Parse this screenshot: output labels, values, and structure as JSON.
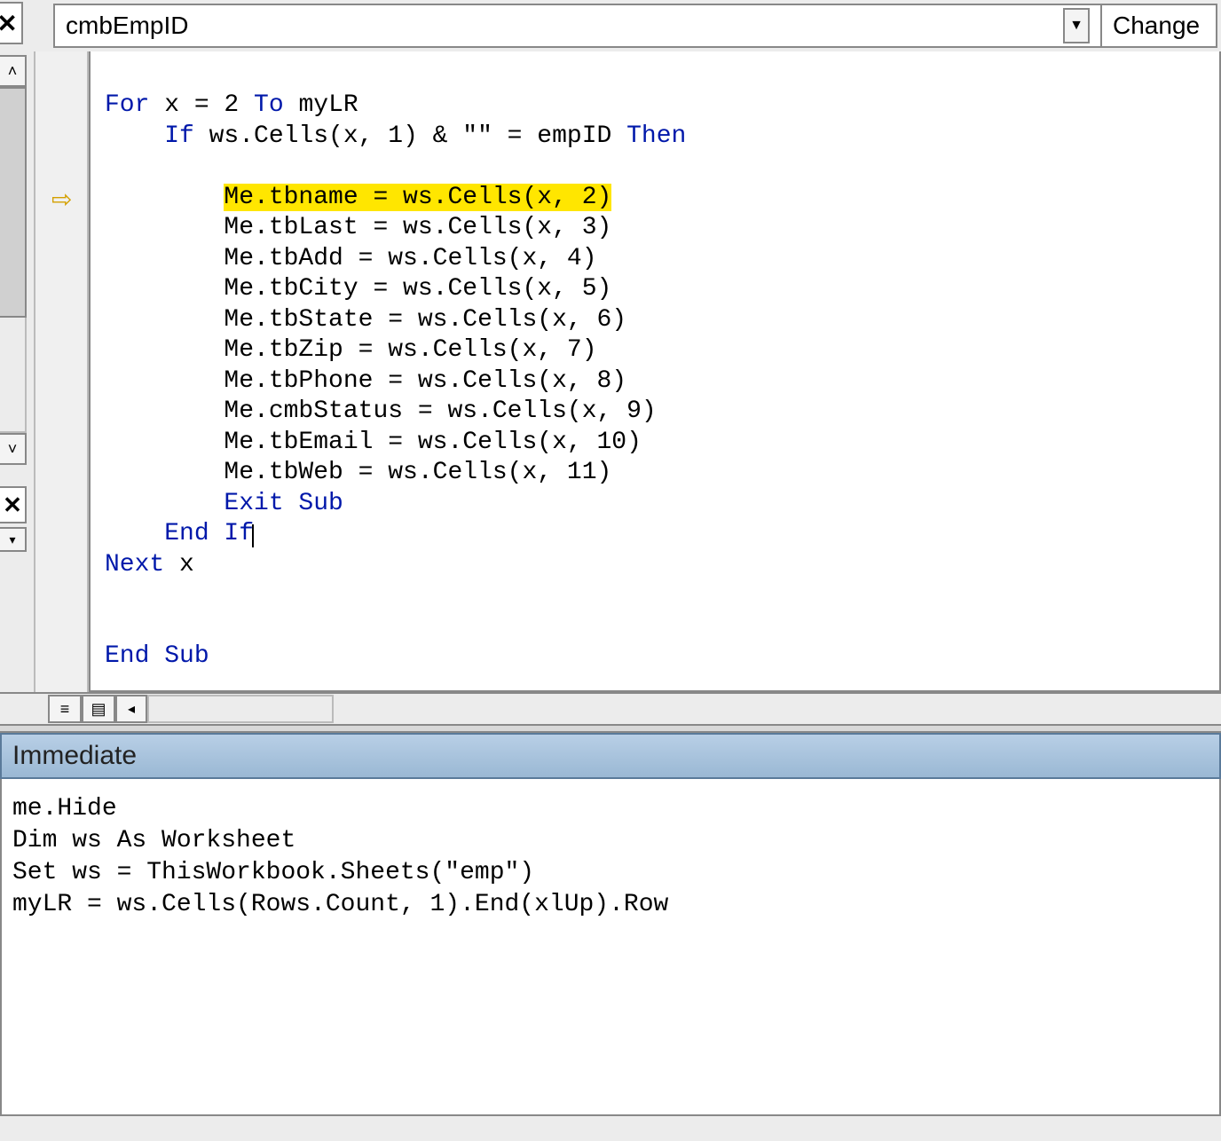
{
  "toolbar": {
    "close_x": "✕",
    "object_combo": "cmbEmpID",
    "proc_combo": "Change"
  },
  "code": {
    "line1_a": "For",
    "line1_b": " x = 2 ",
    "line1_c": "To",
    "line1_d": " myLR",
    "line2_a": "If",
    "line2_b": " ws.Cells(x, 1) & \"\" = empID ",
    "line2_c": "Then",
    "hl": "Me.tbname = ws.Cells(x, 2)",
    "l4": "Me.tbLast = ws.Cells(x, 3)",
    "l5": "Me.tbAdd = ws.Cells(x, 4)",
    "l6": "Me.tbCity = ws.Cells(x, 5)",
    "l7": "Me.tbState = ws.Cells(x, 6)",
    "l8": "Me.tbZip = ws.Cells(x, 7)",
    "l9": "Me.tbPhone = ws.Cells(x, 8)",
    "l10": "Me.cmbStatus = ws.Cells(x, 9)",
    "l11": "Me.tbEmail = ws.Cells(x, 10)",
    "l12": "Me.tbWeb = ws.Cells(x, 11)",
    "exit": "Exit Sub",
    "endif": "End If",
    "next": "Next",
    "next_x": " x",
    "endsub": "End Sub"
  },
  "immediate": {
    "title": "Immediate",
    "l1": "me.Hide",
    "l2": "Dim ws As Worksheet",
    "l3": "Set ws = ThisWorkbook.Sheets(\"emp\")",
    "l4": "myLR = ws.Cells(Rows.Count, 1).End(xlUp).Row"
  },
  "icons": {
    "down_triangle": "▼",
    "up_caret": "˄",
    "down_caret": "˅",
    "left_tri": "◂",
    "view1": "≡",
    "view2": "▤",
    "dropdown_small": "▾"
  }
}
